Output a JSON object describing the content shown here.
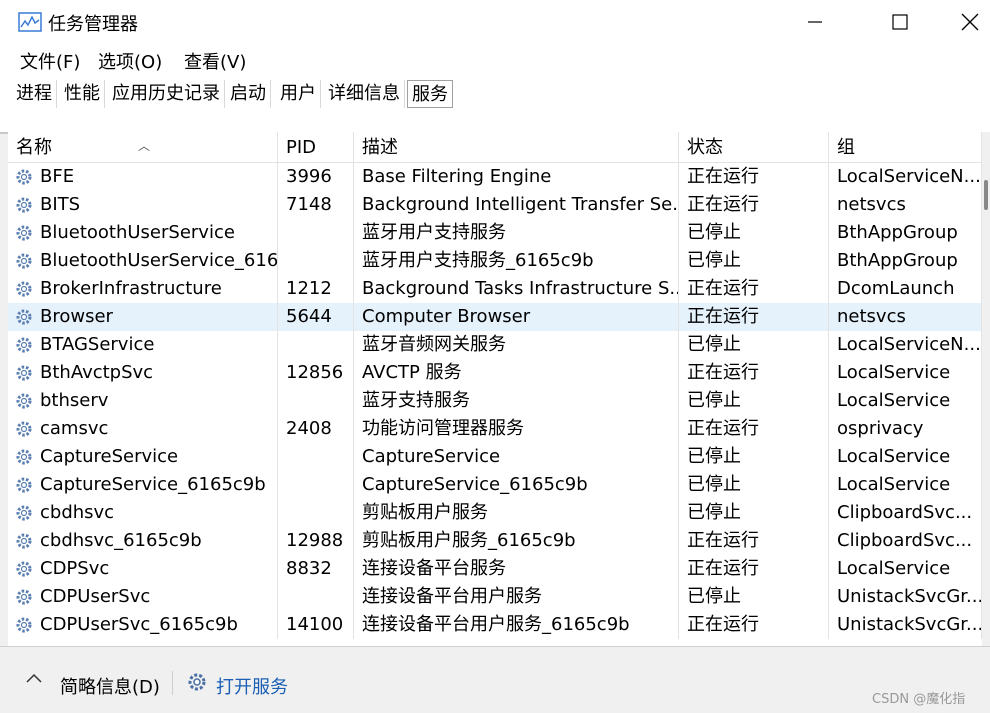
{
  "window": {
    "title": "任务管理器"
  },
  "menu": [
    "文件(F)",
    "选项(O)",
    "查看(V)"
  ],
  "tabs": [
    "进程",
    "性能",
    "应用历史记录",
    "启动",
    "用户",
    "详细信息",
    "服务"
  ],
  "active_tab": "服务",
  "table": {
    "columns": [
      "名称",
      "PID",
      "描述",
      "状态",
      "组"
    ],
    "sort_column": "名称",
    "selected_row": "Browser",
    "rows": [
      {
        "name": "BFE",
        "pid": "3996",
        "desc": "Base Filtering Engine",
        "status": "正在运行",
        "group": "LocalServiceN..."
      },
      {
        "name": "BITS",
        "pid": "7148",
        "desc": "Background Intelligent Transfer Se...",
        "status": "正在运行",
        "group": "netsvcs"
      },
      {
        "name": "BluetoothUserService",
        "pid": "",
        "desc": "蓝牙用户支持服务",
        "status": "已停止",
        "group": "BthAppGroup"
      },
      {
        "name": "BluetoothUserService_616...",
        "pid": "",
        "desc": "蓝牙用户支持服务_6165c9b",
        "status": "已停止",
        "group": "BthAppGroup"
      },
      {
        "name": "BrokerInfrastructure",
        "pid": "1212",
        "desc": "Background Tasks Infrastructure S...",
        "status": "正在运行",
        "group": "DcomLaunch"
      },
      {
        "name": "Browser",
        "pid": "5644",
        "desc": "Computer Browser",
        "status": "正在运行",
        "group": "netsvcs"
      },
      {
        "name": "BTAGService",
        "pid": "",
        "desc": "蓝牙音频网关服务",
        "status": "已停止",
        "group": "LocalServiceN..."
      },
      {
        "name": "BthAvctpSvc",
        "pid": "12856",
        "desc": "AVCTP 服务",
        "status": "正在运行",
        "group": "LocalService"
      },
      {
        "name": "bthserv",
        "pid": "",
        "desc": "蓝牙支持服务",
        "status": "已停止",
        "group": "LocalService"
      },
      {
        "name": "camsvc",
        "pid": "2408",
        "desc": "功能访问管理器服务",
        "status": "正在运行",
        "group": "osprivacy"
      },
      {
        "name": "CaptureService",
        "pid": "",
        "desc": "CaptureService",
        "status": "已停止",
        "group": "LocalService"
      },
      {
        "name": "CaptureService_6165c9b",
        "pid": "",
        "desc": "CaptureService_6165c9b",
        "status": "已停止",
        "group": "LocalService"
      },
      {
        "name": "cbdhsvc",
        "pid": "",
        "desc": "剪贴板用户服务",
        "status": "已停止",
        "group": "ClipboardSvc..."
      },
      {
        "name": "cbdhsvc_6165c9b",
        "pid": "12988",
        "desc": "剪贴板用户服务_6165c9b",
        "status": "正在运行",
        "group": "ClipboardSvc..."
      },
      {
        "name": "CDPSvc",
        "pid": "8832",
        "desc": "连接设备平台服务",
        "status": "正在运行",
        "group": "LocalService"
      },
      {
        "name": "CDPUserSvc",
        "pid": "",
        "desc": "连接设备平台用户服务",
        "status": "已停止",
        "group": "UnistackSvcGr..."
      },
      {
        "name": "CDPUserSvc_6165c9b",
        "pid": "14100",
        "desc": "连接设备平台用户服务_6165c9b",
        "status": "正在运行",
        "group": "UnistackSvcGr..."
      }
    ]
  },
  "footer": {
    "brief_label": "简略信息(D)",
    "open_services_label": "打开服务"
  },
  "watermark": "CSDN @魔化指",
  "icons": {
    "app": "task-manager-icon",
    "service": "gear-icon",
    "minimize": "minimize-icon",
    "maximize": "maximize-icon",
    "close": "close-icon",
    "collapse": "chevron-up-icon"
  },
  "colors": {
    "selected_row": "#e5f1fb",
    "link": "#1a5fb4"
  }
}
